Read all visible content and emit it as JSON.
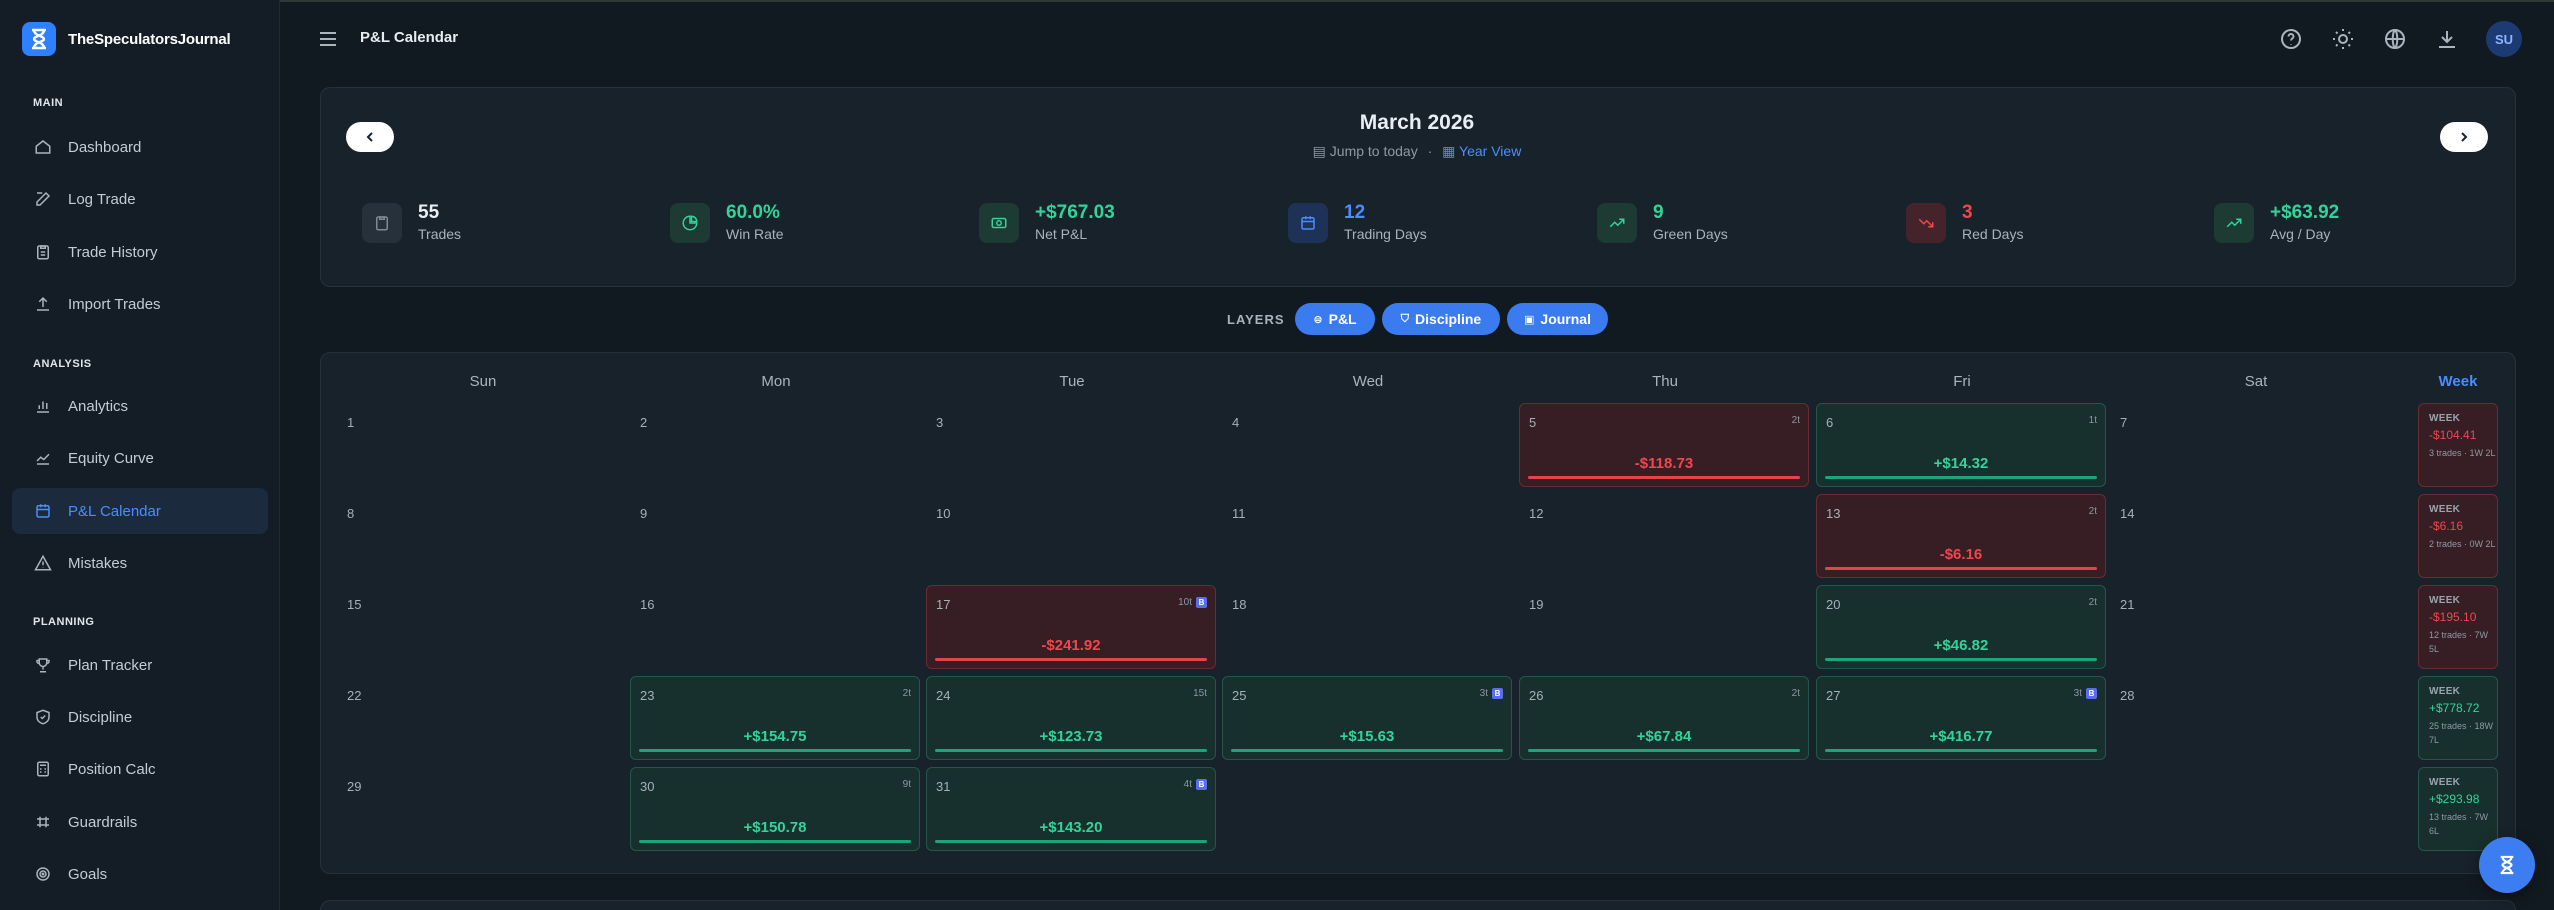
{
  "app": {
    "brand": "TheSpeculatorsJournal",
    "page_title": "P&L Calendar",
    "avatar": "SU"
  },
  "sidebar": {
    "sections": [
      "MAIN",
      "ANALYSIS",
      "PLANNING"
    ],
    "items": [
      {
        "label": "Dashboard",
        "icon": "home-icon"
      },
      {
        "label": "Log Trade",
        "icon": "edit-icon"
      },
      {
        "label": "Trade History",
        "icon": "clipboard-icon"
      },
      {
        "label": "Import Trades",
        "icon": "upload-icon"
      },
      {
        "label": "Analytics",
        "icon": "bar-chart-icon"
      },
      {
        "label": "Equity Curve",
        "icon": "line-chart-icon"
      },
      {
        "label": "P&L Calendar",
        "icon": "calendar-icon",
        "active": true
      },
      {
        "label": "Mistakes",
        "icon": "warning-icon"
      },
      {
        "label": "Plan Tracker",
        "icon": "trophy-icon"
      },
      {
        "label": "Discipline",
        "icon": "shield-icon"
      },
      {
        "label": "Position Calc",
        "icon": "calculator-icon"
      },
      {
        "label": "Guardrails",
        "icon": "guardrail-icon"
      },
      {
        "label": "Goals",
        "icon": "target-icon"
      }
    ]
  },
  "header": {
    "icons": [
      "help-icon",
      "sun-icon",
      "globe-icon",
      "download-icon"
    ]
  },
  "calendar": {
    "month": "March 2026",
    "jump_today": "Jump to today",
    "separator": "·",
    "year_view": "Year View",
    "layers_label": "LAYERS",
    "layers": [
      "P&L",
      "Discipline",
      "Journal"
    ],
    "days_of_week": [
      "Sun",
      "Mon",
      "Tue",
      "Wed",
      "Thu",
      "Fri",
      "Sat"
    ],
    "week_header": "Week",
    "journal_badge": "B",
    "days": [
      {
        "d": "1"
      },
      {
        "d": "2"
      },
      {
        "d": "3"
      },
      {
        "d": "4"
      },
      {
        "d": "5",
        "pnl": "-$118.73",
        "trades": "2t",
        "type": "loss"
      },
      {
        "d": "6",
        "pnl": "+$14.32",
        "trades": "1t",
        "type": "win"
      },
      {
        "d": "7"
      },
      {
        "d": "8"
      },
      {
        "d": "9"
      },
      {
        "d": "10"
      },
      {
        "d": "11"
      },
      {
        "d": "12"
      },
      {
        "d": "13",
        "pnl": "-$6.16",
        "trades": "2t",
        "type": "loss"
      },
      {
        "d": "14"
      },
      {
        "d": "15"
      },
      {
        "d": "16"
      },
      {
        "d": "17",
        "pnl": "-$241.92",
        "trades": "10t",
        "type": "loss",
        "journal": true
      },
      {
        "d": "18"
      },
      {
        "d": "19"
      },
      {
        "d": "20",
        "pnl": "+$46.82",
        "trades": "2t",
        "type": "win"
      },
      {
        "d": "21"
      },
      {
        "d": "22"
      },
      {
        "d": "23",
        "pnl": "+$154.75",
        "trades": "2t",
        "type": "win"
      },
      {
        "d": "24",
        "pnl": "+$123.73",
        "trades": "15t",
        "type": "win"
      },
      {
        "d": "25",
        "pnl": "+$15.63",
        "trades": "3t",
        "type": "win",
        "journal": true
      },
      {
        "d": "26",
        "pnl": "+$67.84",
        "trades": "2t",
        "type": "win"
      },
      {
        "d": "27",
        "pnl": "+$416.77",
        "trades": "3t",
        "type": "win",
        "journal": true
      },
      {
        "d": "28"
      },
      {
        "d": "29"
      },
      {
        "d": "30",
        "pnl": "+$150.78",
        "trades": "9t",
        "type": "win"
      },
      {
        "d": "31",
        "pnl": "+$143.20",
        "trades": "4t",
        "type": "win",
        "journal": true
      }
    ],
    "weeks": [
      {
        "title": "WEEK",
        "pnl": "-$104.41",
        "summary": "3 trades · 1W 2L",
        "type": "loss"
      },
      {
        "title": "WEEK",
        "pnl": "-$6.16",
        "summary": "2 trades · 0W 2L",
        "type": "loss"
      },
      {
        "title": "WEEK",
        "pnl": "-$195.10",
        "summary": "12 trades · 7W 5L",
        "type": "loss"
      },
      {
        "title": "WEEK",
        "pnl": "+$778.72",
        "summary": "25 trades · 18W 7L",
        "type": "win"
      },
      {
        "title": "WEEK",
        "pnl": "+$293.98",
        "summary": "13 trades · 7W 6L",
        "type": "win"
      }
    ]
  },
  "stats": [
    {
      "value": "55",
      "label": "Trades",
      "icon": "clipboard-icon",
      "color": "#e8eef4"
    },
    {
      "value": "60.0%",
      "label": "Win Rate",
      "icon": "pie-icon",
      "color": "#34d399"
    },
    {
      "value": "+$767.03",
      "label": "Net P&L",
      "icon": "money-icon",
      "color": "#34d399"
    },
    {
      "value": "12",
      "label": "Trading Days",
      "icon": "calendar-icon",
      "color": "#4b8dff"
    },
    {
      "value": "9",
      "label": "Green Days",
      "icon": "trend-up-icon",
      "color": "#34d399"
    },
    {
      "value": "3",
      "label": "Red Days",
      "icon": "trend-down-icon",
      "color": "#f0474d"
    },
    {
      "value": "+$63.92",
      "label": "Avg / Day",
      "icon": "trend-up-icon",
      "color": "#34d399"
    }
  ],
  "colors": {
    "accent": "#3b7bf0",
    "win": "#34d399",
    "loss": "#f0474d"
  }
}
